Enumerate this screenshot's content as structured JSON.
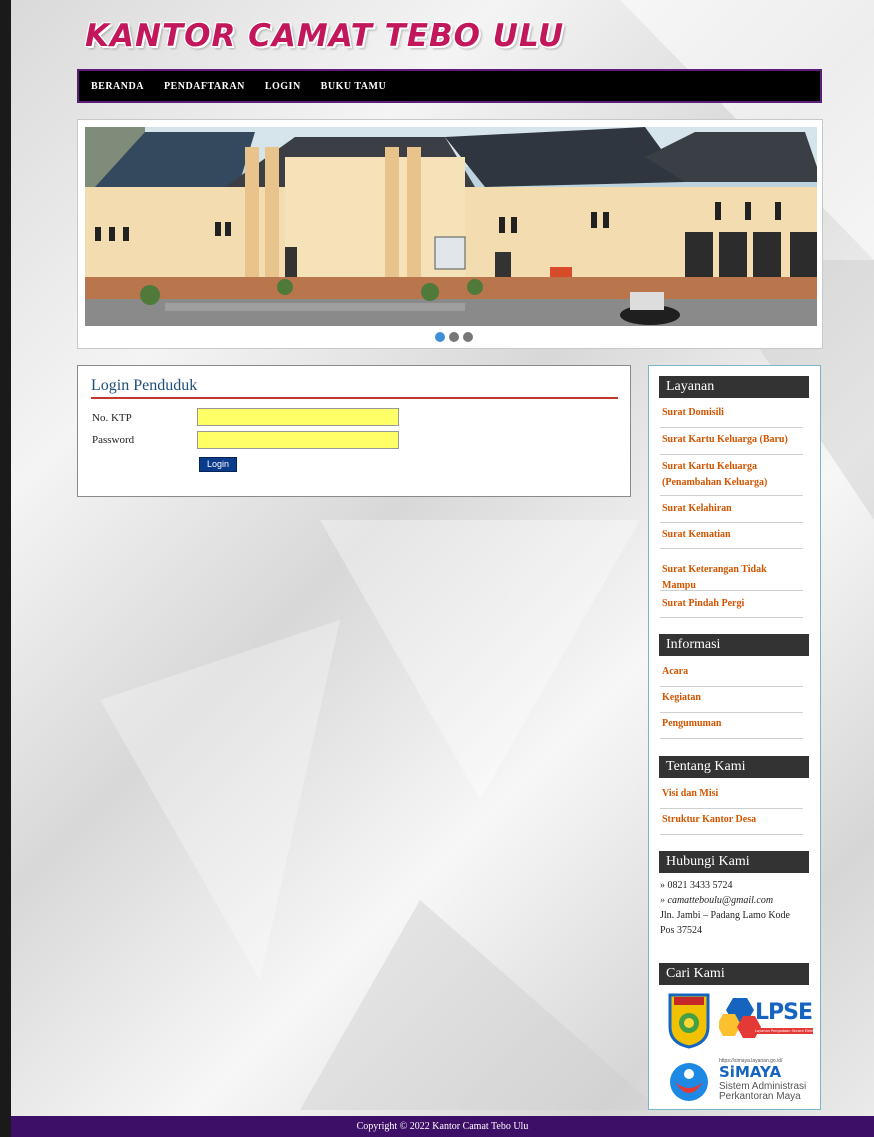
{
  "header": {
    "title": "KANTOR CAMAT TEBO ULU"
  },
  "nav": {
    "items": [
      "BERANDA",
      "PENDAFTARAN",
      "LOGIN",
      "BUKU TAMU"
    ]
  },
  "slider": {
    "dots": 3,
    "active_dot": 0
  },
  "login": {
    "title": "Login Penduduk",
    "ktp_label": "No. KTP",
    "password_label": "Password",
    "ktp_value": "",
    "password_value": "",
    "button_label": "Login"
  },
  "sidebar": {
    "layanan": {
      "heading": "Layanan",
      "links": [
        "Surat Domisili",
        "Surat Kartu Keluarga (Baru)",
        "Surat Kartu Keluarga (Penambahan Keluarga)",
        "Surat Kelahiran",
        "Surat Kematian",
        "Surat Keterangan Tidak Mampu",
        "Surat Pindah Pergi"
      ]
    },
    "informasi": {
      "heading": "Informasi",
      "links": [
        "Acara",
        "Kegiatan",
        "Pengumuman"
      ]
    },
    "tentang": {
      "heading": "Tentang Kami",
      "links": [
        "Visi dan Misi",
        "Struktur Kantor Desa"
      ]
    },
    "hubungi": {
      "heading": "Hubungi Kami",
      "phone": "» 0821 3433 5724",
      "email": "» camatteboulu@gmail.com",
      "address": "Jln. Jambi – Padang Lamo Kode Pos 37524"
    },
    "cari": {
      "heading": "Cari Kami",
      "lpse_text": "LPSE",
      "lpse_sub": "Layanan Pengadaan Secara Elektronik",
      "simaya_url": "https://simaya.layanan.go.id/",
      "simaya_name": "SiMAYA",
      "simaya_line1": "Sistem Administrasi",
      "simaya_line2": "Perkantoran Maya"
    }
  },
  "footer": {
    "text": "Copyright © 2022 Kantor Camat Tebo Ulu"
  },
  "colors": {
    "accent": "#c2185b",
    "footer": "#3d0f66",
    "link": "#d35400",
    "input_bg": "#ffff66"
  }
}
